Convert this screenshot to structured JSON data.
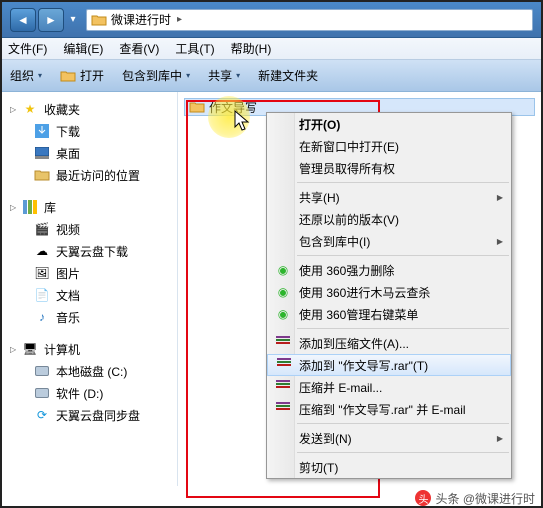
{
  "titlebar": {
    "path": "微课进行时",
    "sep": "▸"
  },
  "menubar": [
    "文件(F)",
    "编辑(E)",
    "查看(V)",
    "工具(T)",
    "帮助(H)"
  ],
  "toolbar": {
    "org": "组织",
    "open": "打开",
    "include": "包含到库中",
    "share": "共享",
    "newfolder": "新建文件夹"
  },
  "sidebar": {
    "fav_label": "收藏夹",
    "fav_items": [
      "下载",
      "桌面",
      "最近访问的位置"
    ],
    "lib_label": "库",
    "lib_items": [
      "视频",
      "天翼云盘下载",
      "图片",
      "文档",
      "音乐"
    ],
    "comp_label": "计算机",
    "comp_items": [
      "本地磁盘 (C:)",
      "软件 (D:)",
      "天翼云盘同步盘"
    ]
  },
  "content": {
    "folder_name": "作文导写"
  },
  "ctx": {
    "open": "打开(O)",
    "newwin": "在新窗口中打开(E)",
    "admin": "管理员取得所有权",
    "share": "共享(H)",
    "restore": "还原以前的版本(V)",
    "include": "包含到库中(I)",
    "del360": "使用 360强力删除",
    "trojan": "使用 360进行木马云查杀",
    "rightmenu": "使用 360管理右键菜单",
    "addarchive": "添加到压缩文件(A)...",
    "addrar": "添加到 \"作文导写.rar\"(T)",
    "comp_email": "压缩并 E-mail...",
    "comp_email2": "压缩到 \"作文导写.rar\" 并 E-mail",
    "sendto": "发送到(N)",
    "cut": "剪切(T)"
  },
  "footer": {
    "source": "头条",
    "author": "@微课进行时"
  }
}
